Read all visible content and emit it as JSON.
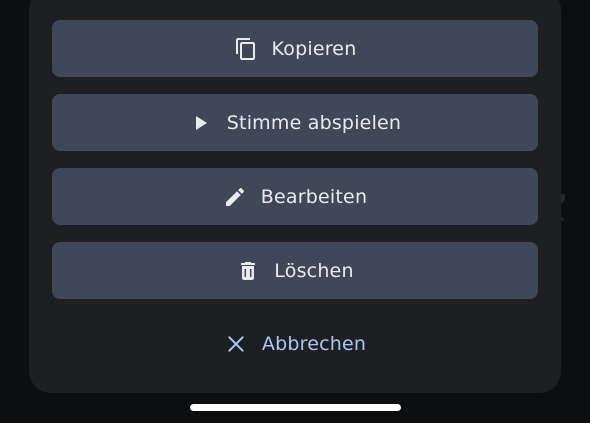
{
  "sheet": {
    "actions": [
      {
        "label": "Kopieren",
        "icon": "copy-icon"
      },
      {
        "label": "Stimme abspielen",
        "icon": "play-icon"
      },
      {
        "label": "Bearbeiten",
        "icon": "pencil-icon"
      },
      {
        "label": "Löschen",
        "icon": "trash-icon"
      }
    ],
    "cancel": {
      "label": "Abbrechen",
      "icon": "close-icon"
    }
  },
  "colors": {
    "background": "#0d0e10",
    "sheet": "#1d1f23",
    "button": "#3f4758",
    "button_text": "#e9ebef",
    "cancel_text": "#aac7f3"
  }
}
